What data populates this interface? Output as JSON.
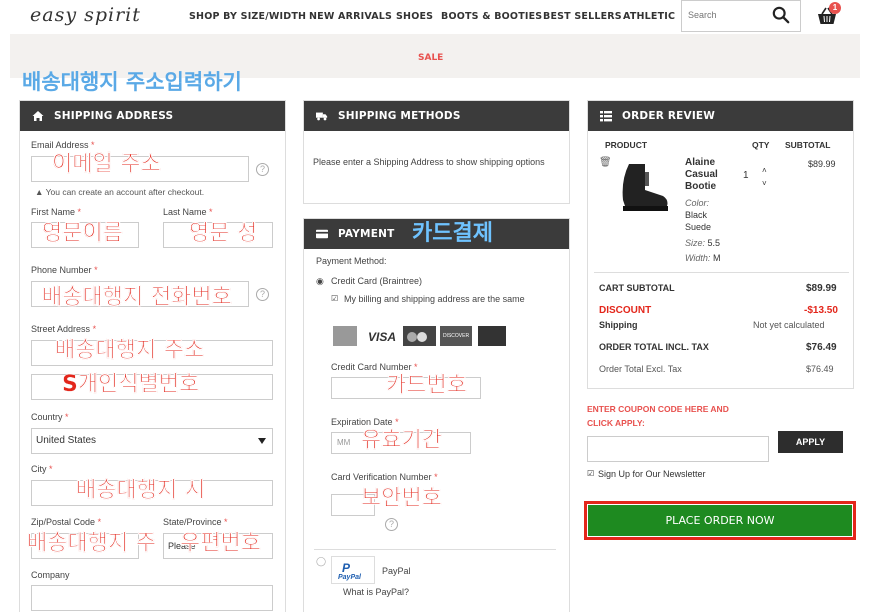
{
  "header": {
    "logo": "easy spirit",
    "nav": [
      "SHOP BY SIZE/WIDTH",
      "NEW ARRIVALS",
      "SHOES",
      "BOOTS & BOOTIES",
      "BEST SELLERS",
      "ATHLETIC"
    ],
    "sale": "SALE",
    "search_placeholder": "Search",
    "cart_count": "1"
  },
  "annotations": {
    "page_title": "배송대행지 주소입력하기",
    "email": "이메일 주소",
    "first_name": "영문이름",
    "last_name": "영문 성",
    "phone": "배송대행지 전화번호",
    "street1": "배송대행지 주소",
    "street2": "S개인식별번호",
    "city": "배송대행지 시",
    "zip": "배송대행지 주",
    "zip2": "우편번호",
    "card_payment": "카드결제",
    "card_number": "카드번호",
    "expiration": "유효기간",
    "cvv": "보안번호"
  },
  "shipping_address": {
    "title": "SHIPPING ADDRESS",
    "email_label": "Email Address",
    "account_note": "You can create an account after checkout.",
    "first_name_label": "First Name",
    "last_name_label": "Last Name",
    "phone_label": "Phone Number",
    "street_label": "Street Address",
    "country_label": "Country",
    "country_value": "United States",
    "city_label": "City",
    "zip_label": "Zip/Postal Code",
    "state_label": "State/Province",
    "state_placeholder": "Please",
    "company_label": "Company",
    "required_mark": "*"
  },
  "shipping_methods": {
    "title": "SHIPPING METHODS",
    "message": "Please enter a Shipping Address to show shipping options"
  },
  "payment": {
    "title": "PAYMENT",
    "method_label": "Payment Method:",
    "credit_card_option": "Credit Card (Braintree)",
    "same_address": "My billing and shipping address are the same",
    "card_brands": [
      "AMEX",
      "VISA",
      "MasterCard",
      "DISCOVER",
      "JCB"
    ],
    "card_number_label": "Credit Card Number",
    "expiration_label": "Expiration Date",
    "expiration_placeholder": "MM",
    "cvv_label": "Card Verification Number",
    "paypal_label": "PayPal",
    "paypal_link": "What is PayPal?",
    "paypal_logo": "PayPal"
  },
  "order_review": {
    "title": "ORDER REVIEW",
    "col_product": "PRODUCT",
    "col_qty": "QTY",
    "col_subtotal": "SUBTOTAL",
    "product_name": [
      "Alaine",
      "Casual",
      "Bootie"
    ],
    "qty": "1",
    "subtotal": "$89.99",
    "color_label": "Color:",
    "color_value": [
      "Black",
      "Suede"
    ],
    "size_label": "Size:",
    "size_value": "5.5",
    "width_label": "Width:",
    "width_value": "M",
    "cart_subtotal_label": "CART SUBTOTAL",
    "cart_subtotal_value": "$89.99",
    "discount_label": "DISCOUNT",
    "discount_value": "-$13.50",
    "shipping_label": "Shipping",
    "shipping_value": "Not yet calculated",
    "total_incl_label": "ORDER TOTAL INCL. TAX",
    "total_incl_value": "$76.49",
    "total_excl_label": "Order Total Excl. Tax",
    "total_excl_value": "$76.49",
    "coupon_label": [
      "ENTER COUPON CODE HERE AND",
      "CLICK APPLY:"
    ],
    "apply_button": "APPLY",
    "newsletter": "Sign Up for Our Newsletter",
    "place_order": "PLACE ORDER NOW"
  },
  "colors": {
    "header_dark": "#3b3b3b",
    "accent_red": "#e8514e",
    "place_order_green": "#1e8a20",
    "annotation_red": "#e3261b",
    "annotation_blue": "#2278c9"
  }
}
